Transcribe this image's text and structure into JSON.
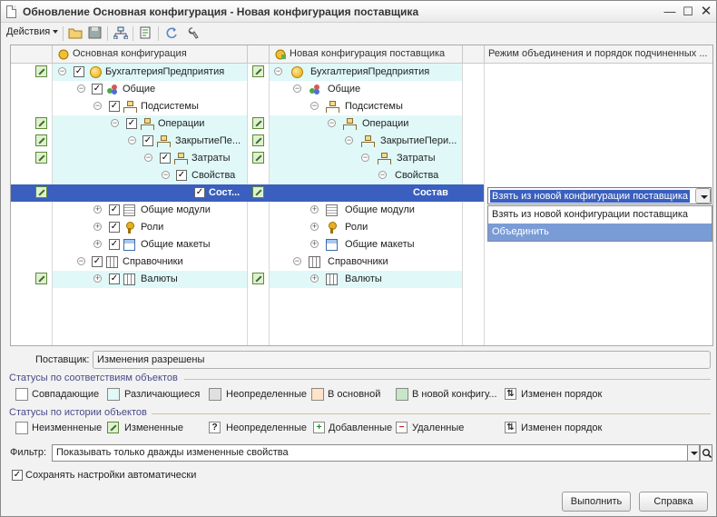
{
  "window": {
    "title": "Обновление Основная конфигурация - Новая конфигурация поставщика"
  },
  "toolbar": {
    "actions_label": "Действия"
  },
  "grid": {
    "headers": {
      "main": "Основная конфигурация",
      "vendor": "Новая конфигурация поставщика",
      "mode": "Режим объединения и порядок подчиненных ..."
    },
    "rows": [
      {
        "main": "БухгалтерияПредприятия",
        "vendor": "БухгалтерияПредприятия"
      },
      {
        "main": "Общие",
        "vendor": "Общие"
      },
      {
        "main": "Подсистемы",
        "vendor": "Подсистемы"
      },
      {
        "main": "Операции",
        "vendor": "Операции"
      },
      {
        "main": "ЗакрытиеПе...",
        "vendor": "ЗакрытиеПери..."
      },
      {
        "main": "Затраты",
        "vendor": "Затраты"
      },
      {
        "main": "Свойства",
        "vendor": "Свойства"
      },
      {
        "main": "Сост...",
        "vendor": "Состав",
        "mode": "Взять из новой конфигурации поставщика"
      },
      {
        "main": "Общие модули",
        "vendor": "Общие модули"
      },
      {
        "main": "Роли",
        "vendor": "Роли"
      },
      {
        "main": "Общие макеты",
        "vendor": "Общие макеты"
      },
      {
        "main": "Справочники",
        "vendor": "Справочники"
      },
      {
        "main": "Валюты",
        "vendor": "Валюты"
      }
    ],
    "dropdown_options": [
      "Взять из новой конфигурации поставщика",
      "Объединить"
    ]
  },
  "supplier": {
    "label": "Поставщик:",
    "value": "Изменения разрешены"
  },
  "status_by_match": {
    "title": "Статусы по соответствиям объектов",
    "items": [
      "Совпадающие",
      "Различающиеся",
      "Неопределенные",
      "В основной",
      "В новой конфигу...",
      "Изменен порядок"
    ],
    "colors": [
      "#ffffff",
      "#e0f8f8",
      "#e0e0e0",
      "#ffe4c8",
      "#c8e6c8"
    ]
  },
  "status_by_history": {
    "title": "Статусы по истории объектов",
    "items": [
      "Неизменненые",
      "Измененные",
      "Неопределенные",
      "Добавленные",
      "Удаленные",
      "Изменен порядок"
    ]
  },
  "filter": {
    "label": "Фильтр:",
    "value": "Показывать только дважды измененные свойства"
  },
  "save_settings": {
    "label": "Сохранять настройки автоматически"
  },
  "buttons": {
    "run": "Выполнить",
    "help": "Справка"
  }
}
